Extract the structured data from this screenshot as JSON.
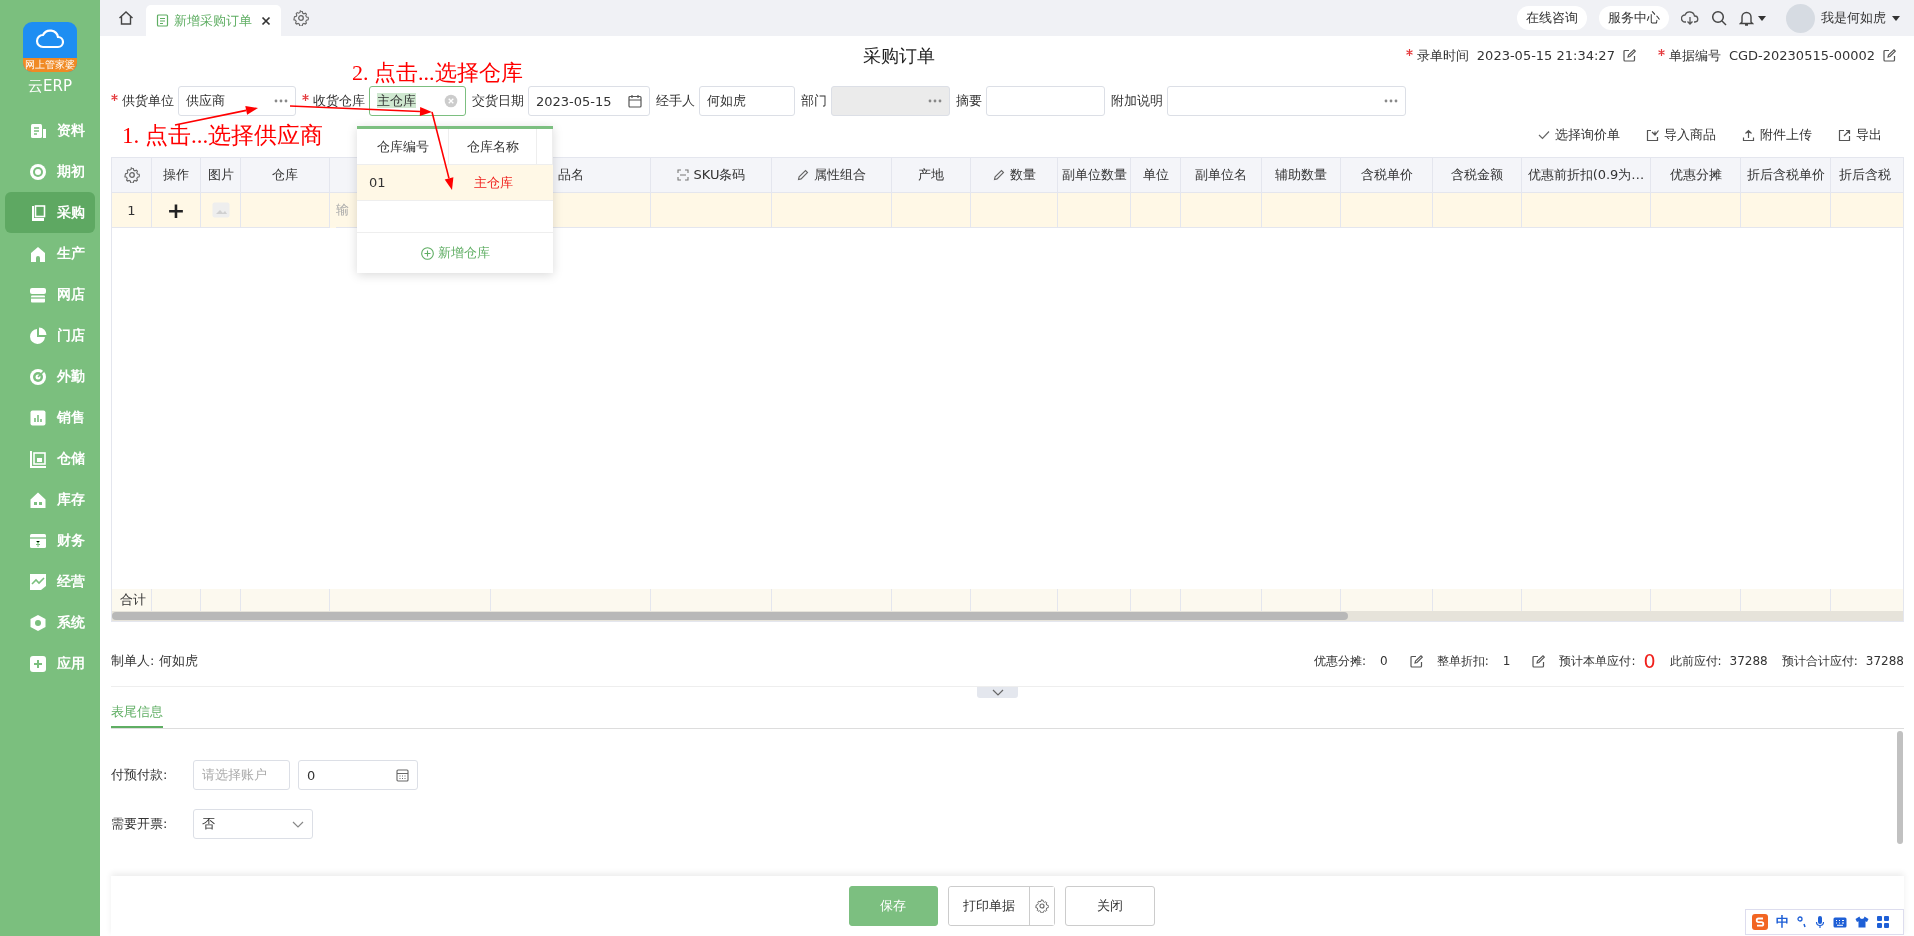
{
  "sidebar": {
    "logo_text": "网上管家婆",
    "app_name": "云ERP",
    "items": [
      {
        "label": "资料",
        "selected": false
      },
      {
        "label": "期初",
        "selected": false
      },
      {
        "label": "采购",
        "selected": true
      },
      {
        "label": "生产",
        "selected": false
      },
      {
        "label": "网店",
        "selected": false
      },
      {
        "label": "门店",
        "selected": false
      },
      {
        "label": "外勤",
        "selected": false
      },
      {
        "label": "销售",
        "selected": false
      },
      {
        "label": "仓储",
        "selected": false
      },
      {
        "label": "库存",
        "selected": false
      },
      {
        "label": "财务",
        "selected": false
      },
      {
        "label": "经营",
        "selected": false
      },
      {
        "label": "系统",
        "selected": false
      },
      {
        "label": "应用",
        "selected": false
      }
    ]
  },
  "topbar": {
    "tabs": [
      {
        "label": "新增采购订单",
        "selected": true
      }
    ],
    "links": [
      "在线咨询",
      "服务中心"
    ],
    "user": "我是何如虎"
  },
  "header": {
    "title": "采购订单",
    "meta": [
      {
        "label": "录单时间",
        "value": "2023-05-15 21:34:27",
        "required": true
      },
      {
        "label": "单据编号",
        "value": "CGD-20230515-00002",
        "required": true
      }
    ]
  },
  "form_fields": [
    {
      "label": "供货单位",
      "required": true,
      "kind": "lookup",
      "value": "供应商",
      "focused": false,
      "disabled": false
    },
    {
      "label": "收货仓库",
      "required": true,
      "kind": "clearable",
      "value": "主仓库",
      "focused": true,
      "disabled": false
    },
    {
      "label": "交货日期",
      "required": false,
      "kind": "date",
      "value": "2023-05-15",
      "focused": false,
      "disabled": false
    },
    {
      "label": "经手人",
      "required": false,
      "kind": "text",
      "value": "何如虎",
      "focused": false,
      "disabled": false
    },
    {
      "label": "部门",
      "required": false,
      "kind": "lookup",
      "focused": false,
      "disabled": true
    },
    {
      "label": "摘要",
      "required": false,
      "kind": "text",
      "focused": false,
      "disabled": false
    },
    {
      "label": "附加说明",
      "required": false,
      "kind": "lookup",
      "focused": false,
      "disabled": false
    }
  ],
  "actions": [
    {
      "label": "选择询价单",
      "kind": "check"
    },
    {
      "label": "导入商品",
      "kind": "import"
    },
    {
      "label": "附件上传",
      "kind": "upload"
    },
    {
      "label": "导出",
      "kind": "export"
    }
  ],
  "table": {
    "columns": [
      {
        "kind": "settings"
      },
      {
        "label": "操作"
      },
      {
        "label": "图片"
      },
      {
        "label": "仓库"
      },
      {},
      {
        "label": "品名"
      },
      {
        "label": "SKU条码",
        "kind": "barcode"
      },
      {
        "label": "属性组合",
        "kind": "editable"
      },
      {
        "label": "产地"
      },
      {
        "label": "数量",
        "kind": "editable"
      },
      {
        "label": "副单位数量"
      },
      {
        "label": "单位"
      },
      {
        "label": "副单位名"
      },
      {
        "label": "辅助数量"
      },
      {
        "label": "含税单价"
      },
      {
        "label": "含税金额"
      },
      {
        "label": "优惠前折扣(0.9为…"
      },
      {
        "label": "优惠分摊"
      },
      {
        "label": "折后含税单价"
      },
      {
        "label": "折后含税"
      }
    ],
    "rows": [
      {
        "selected": true,
        "number": "1",
        "add": "+",
        "hint": "输"
      }
    ],
    "total_label": "合计"
  },
  "dropdown": {
    "columns": [
      "仓库编号",
      "仓库名称"
    ],
    "rows": [
      {
        "code": "01",
        "name": "主仓库",
        "selected": true
      }
    ],
    "add_label": "新增仓库"
  },
  "annotations": [
    "2. 点击...选择仓库",
    "1. 点击...选择供应商"
  ],
  "summary": {
    "maker_label": "制单人:",
    "maker": "何如虎",
    "items": [
      {
        "label": "优惠分摊:",
        "value": "0",
        "kind": "editable"
      },
      {
        "label": "整单折扣:",
        "value": "1",
        "kind": "editable"
      },
      {
        "label": "预计本单应付:",
        "value": "0",
        "kind": "emphasis"
      },
      {
        "label": "此前应付:",
        "value": "37288",
        "kind": "plain"
      },
      {
        "label": "预计合计应付:",
        "value": "37288",
        "kind": "plain"
      }
    ]
  },
  "footer_tabs": [
    {
      "label": "表尾信息",
      "selected": true
    }
  ],
  "footer_fields": [
    {
      "label": "付预付款:",
      "kind": "account",
      "placeholder": "请选择账户",
      "value": "0"
    },
    {
      "label": "需要开票:",
      "kind": "select",
      "value": "否"
    }
  ],
  "buttons": [
    {
      "label": "保存",
      "kind": "primary"
    },
    {
      "label": "打印单据",
      "kind": "split"
    },
    {
      "label": "关闭",
      "kind": "plain"
    }
  ],
  "ime": {
    "label": "中"
  }
}
